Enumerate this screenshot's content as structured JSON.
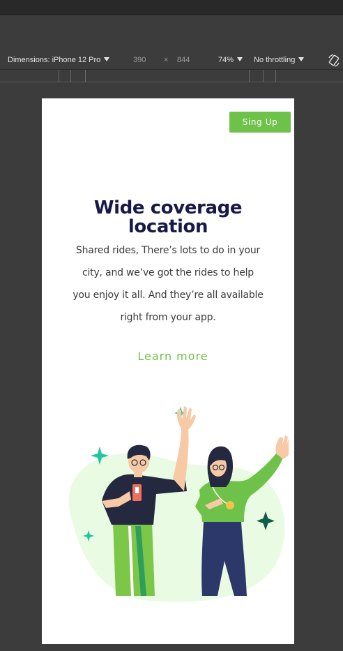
{
  "devtools": {
    "dimensions_label": "Dimensions: iPhone 12 Pro",
    "width": "390",
    "times": "×",
    "height": "844",
    "zoom": "74%",
    "throttling": "No throttling"
  },
  "page": {
    "signup_label": "Sing Up",
    "title_line1": "Wide coverage",
    "title_line2": "location",
    "description": "Shared rides, There’s lots to do in your city, and we’ve got the rides to help you enjoy it all. And they’re all available right from your app.",
    "learn_more": "Learn more"
  },
  "colors": {
    "accent": "#6ec24a",
    "title": "#161a45",
    "blob": "#e9fbe3",
    "sparkle_teal": "#1fc6a0",
    "sparkle_dark": "#0f5e48"
  },
  "icons": [
    "dropdown-caret-icon",
    "rotate-icon",
    "sparkle-icon"
  ]
}
